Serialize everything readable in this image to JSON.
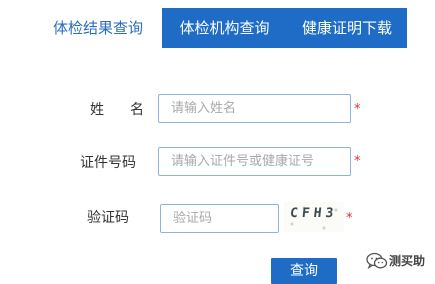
{
  "tabs": [
    {
      "label": "体检结果查询",
      "active": true
    },
    {
      "label": "体检机构查询",
      "active": false
    },
    {
      "label": "健康证明下载",
      "active": false
    }
  ],
  "form": {
    "name": {
      "label": "姓名",
      "placeholder": "请输入姓名",
      "value": "",
      "required_mark": "*"
    },
    "id_number": {
      "label": "证件号码",
      "placeholder": "请输入证件号或健康证号",
      "value": "",
      "required_mark": "*"
    },
    "captcha": {
      "label": "验证码",
      "placeholder": "验证码",
      "value": "",
      "image_text": "CFH3",
      "required_mark": "*"
    },
    "submit_label": "查询"
  },
  "watermark": {
    "text": "测买助"
  },
  "colors": {
    "primary": "#1e6cc6",
    "active_tab_text": "#2a6dbd",
    "input_border": "#8fb3da",
    "required": "#e03030",
    "placeholder": "#a9a9a9"
  }
}
